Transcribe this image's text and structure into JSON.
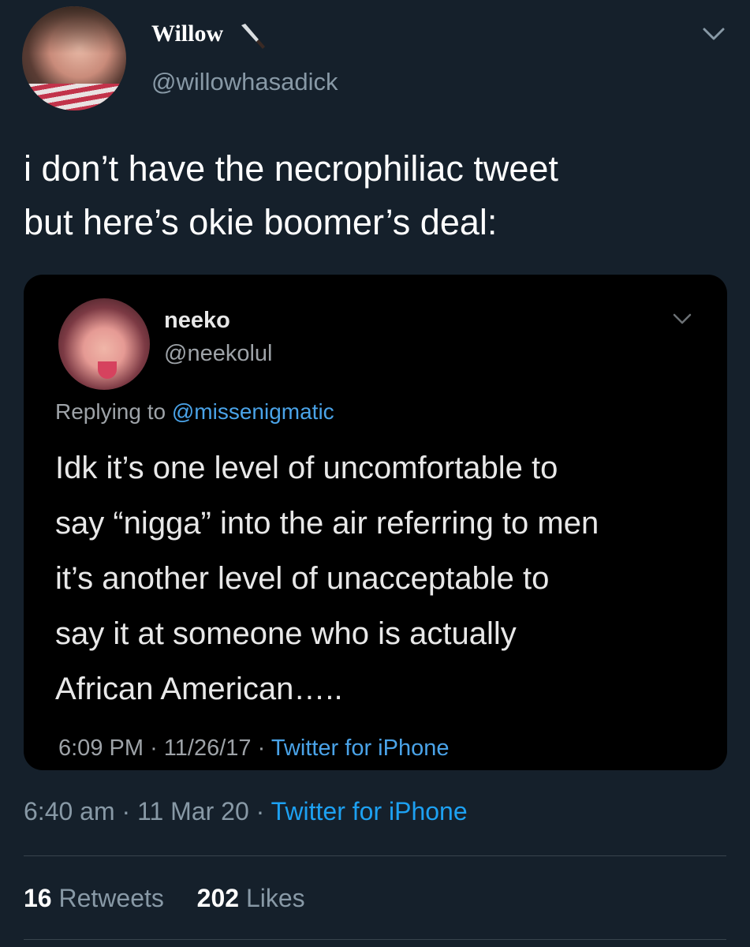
{
  "tweet": {
    "author": {
      "display_name": "Willow",
      "handle": "@willowhasadick",
      "name_icon": "knife-icon"
    },
    "text_lines": [
      "i don’t have the necrophiliac tweet",
      "but here’s okie boomer’s deal:"
    ],
    "timestamp": "6:40 am",
    "date": "11 Mar 20",
    "separator": "·",
    "source": "Twitter for iPhone",
    "stats": {
      "retweets_count": "16",
      "retweets_label": "Retweets",
      "likes_count": "202",
      "likes_label": "Likes"
    }
  },
  "quoted": {
    "author": {
      "display_name": "neeko",
      "handle": "@neekolul"
    },
    "replying_prefix": "Replying to",
    "replying_to": "@missenigmatic",
    "text_lines": [
      "Idk it’s one level of uncomfortable to",
      "say “nigga” into the air referring to men",
      "it’s another level of unacceptable to",
      "say it at someone who is actually",
      "African American….."
    ],
    "timestamp": "6:09 PM",
    "date": "11/26/17",
    "separator": "·",
    "source": "Twitter for iPhone"
  },
  "colors": {
    "background": "#15202b",
    "quote_background": "#000000",
    "link": "#1da1f2",
    "secondary_text": "#8899a6"
  }
}
